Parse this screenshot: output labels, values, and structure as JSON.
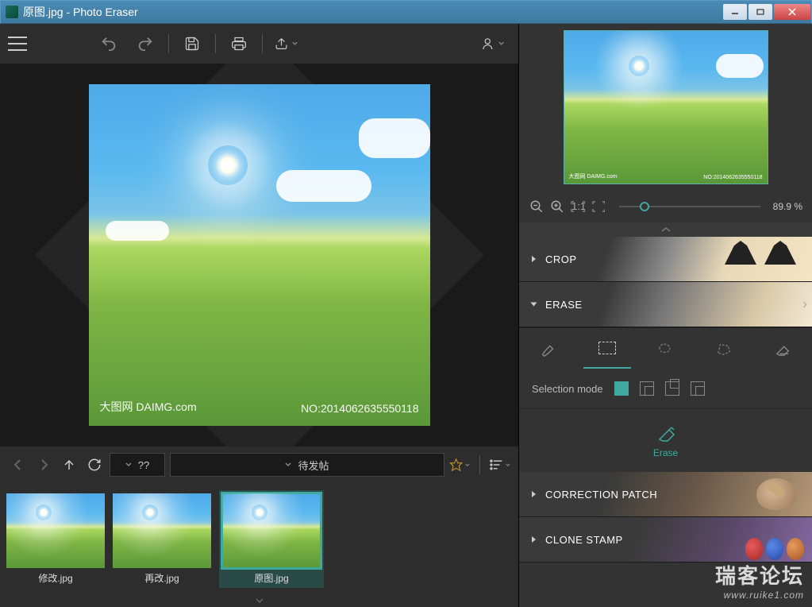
{
  "window": {
    "title": "原图.jpg - Photo Eraser"
  },
  "canvas": {
    "watermark_left": "大图网 DAIMG.com",
    "watermark_right": "NO:2014062635550118"
  },
  "nav": {
    "breadcrumb1": "??",
    "breadcrumb2": "待发帖"
  },
  "thumbs": [
    {
      "label": "修改.jpg",
      "active": false
    },
    {
      "label": "再改.jpg",
      "active": false
    },
    {
      "label": "原图.jpg",
      "active": true
    }
  ],
  "zoom": {
    "percent": "89.9 %"
  },
  "sections": {
    "crop": "CROP",
    "erase": "ERASE",
    "correction": "CORRECTION PATCH",
    "clone": "CLONE STAMP"
  },
  "selection_mode_label": "Selection mode",
  "erase_action": "Erase",
  "forum_watermark": {
    "cn": "瑞客论坛",
    "en": "www.ruike1.com"
  },
  "chart_data": null
}
